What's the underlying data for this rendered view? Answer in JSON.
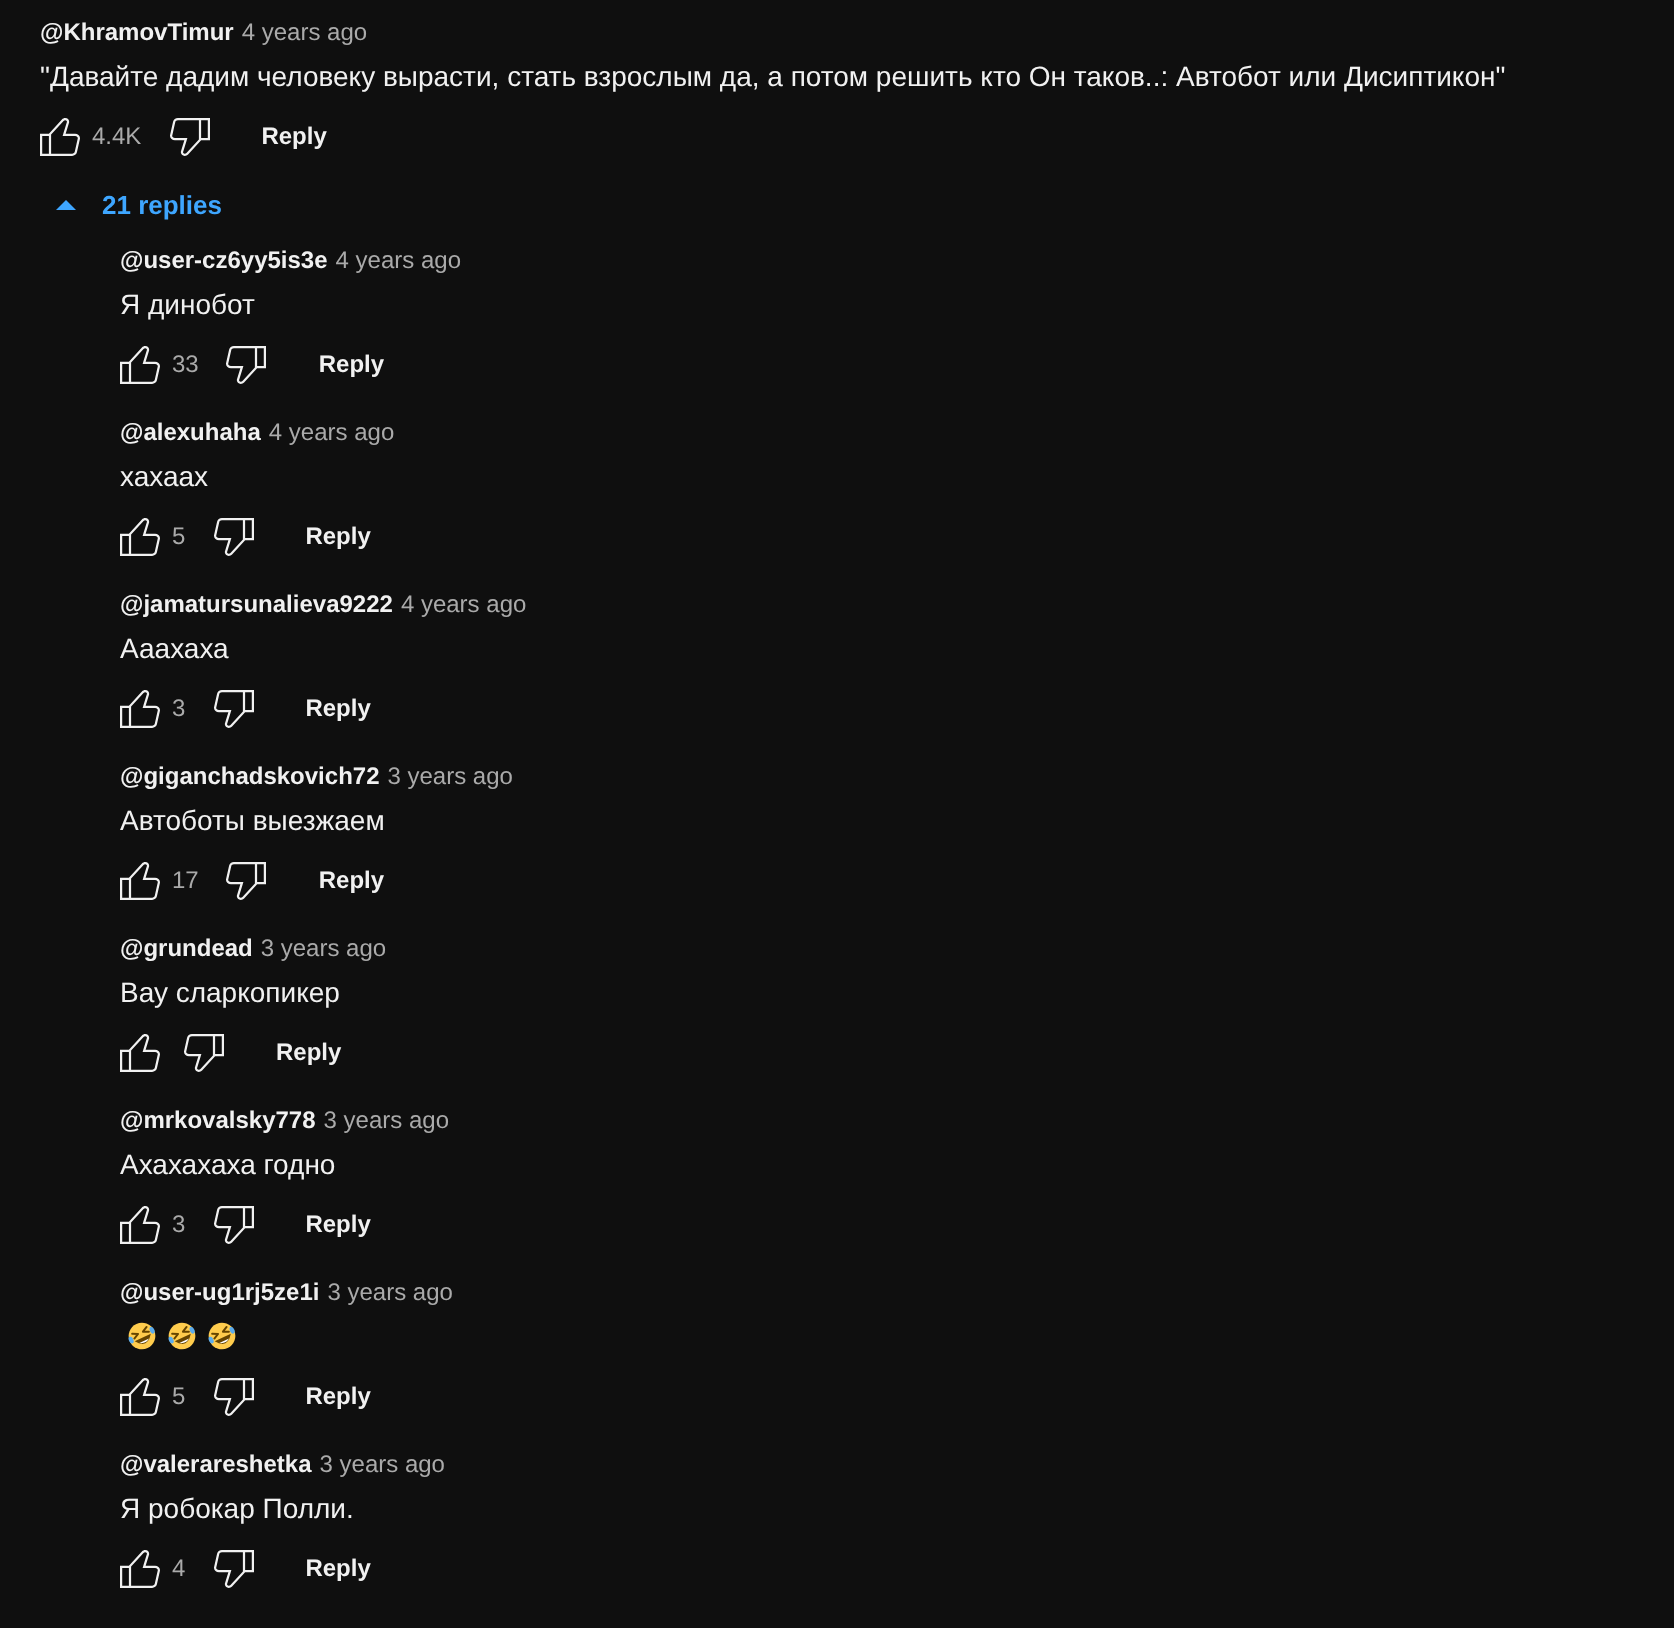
{
  "comment": {
    "author": "@KhramovTimur",
    "time": "4 years ago",
    "text": "\"Давайте дадим человеку вырасти, стать взрослым да, а потом решить кто Он таков..: Автобот или Дисиптикон\"",
    "likes": "4.4K",
    "reply_label": "Reply"
  },
  "replies_toggle": {
    "label": "21 replies",
    "expanded": true
  },
  "replies": [
    {
      "author": "@user-cz6yy5is3e",
      "time": "4 years ago",
      "text": "Я динобот",
      "likes": "33",
      "reply_label": "Reply"
    },
    {
      "author": "@alexuhaha",
      "time": "4 years ago",
      "text": "хахаах",
      "likes": "5",
      "reply_label": "Reply"
    },
    {
      "author": "@jamatursunalieva9222",
      "time": "4 years ago",
      "text": "Ааахаха",
      "likes": "3",
      "reply_label": "Reply"
    },
    {
      "author": "@giganchadskovich72",
      "time": "3 years ago",
      "text": "Автоботы выезжаем",
      "likes": "17",
      "reply_label": "Reply"
    },
    {
      "author": "@grundead",
      "time": "3 years ago",
      "text": "Вау сларкопикер",
      "reply_label": "Reply"
    },
    {
      "author": "@mrkovalsky778",
      "time": "3 years ago",
      "text": "Ахахахаха годно",
      "likes": "3",
      "reply_label": "Reply"
    },
    {
      "author": "@user-ug1rj5ze1i",
      "time": "3 years ago",
      "emojis": [
        {
          "kind": "rofl"
        },
        {
          "kind": "rofl"
        },
        {
          "kind": "rofl"
        }
      ],
      "likes": "5",
      "reply_label": "Reply"
    },
    {
      "author": "@valerareshetka",
      "time": "3 years ago",
      "text": "Я робокар Полли.",
      "likes": "4",
      "reply_label": "Reply"
    }
  ]
}
